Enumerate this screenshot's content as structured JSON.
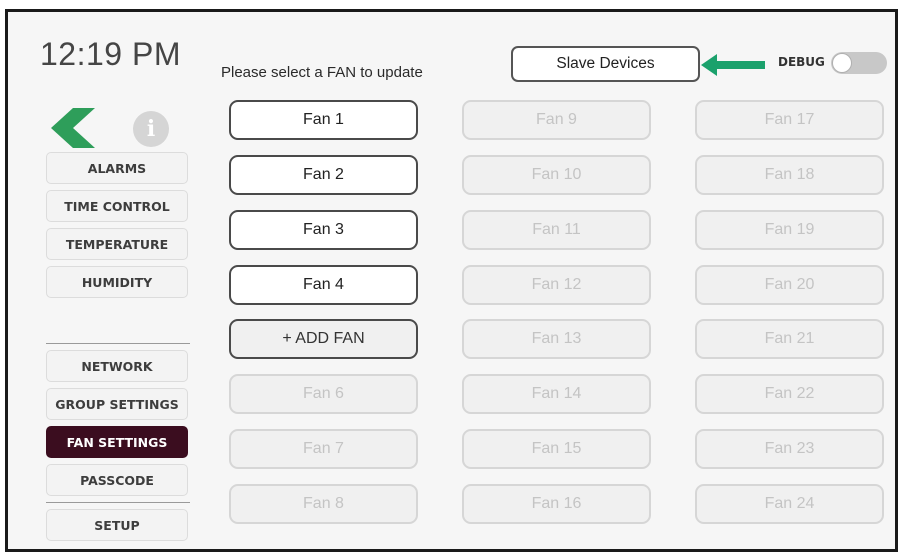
{
  "header": {
    "time": "12:19 PM",
    "prompt": "Please select a FAN to update",
    "slave_devices_label": "Slave Devices",
    "debug_label": "DEBUG",
    "debug_on": false
  },
  "sidebar": {
    "top_items": [
      {
        "label": "ALARMS"
      },
      {
        "label": "TIME CONTROL"
      },
      {
        "label": "TEMPERATURE"
      },
      {
        "label": "HUMIDITY"
      }
    ],
    "bottom_items": [
      {
        "label": "NETWORK"
      },
      {
        "label": "GROUP SETTINGS"
      },
      {
        "label": "FAN SETTINGS",
        "active": true
      },
      {
        "label": "PASSCODE"
      },
      {
        "label": "SETUP"
      }
    ],
    "info_glyph": "i"
  },
  "fans": {
    "col1": [
      "Fan 1",
      "Fan 2",
      "Fan 3",
      "Fan 4",
      "+ ADD FAN",
      "Fan 6",
      "Fan 7",
      "Fan 8"
    ],
    "col2": [
      "Fan 9",
      "Fan 10",
      "Fan 11",
      "Fan 12",
      "Fan 13",
      "Fan 14",
      "Fan 15",
      "Fan 16"
    ],
    "col3": [
      "Fan 17",
      "Fan 18",
      "Fan 19",
      "Fan 20",
      "Fan 21",
      "Fan 22",
      "Fan 23",
      "Fan 24"
    ]
  },
  "colors": {
    "accent_green": "#1ba16c",
    "active_nav": "#3b0d1f",
    "back_arrow": "#2e9e5a"
  },
  "icons": {
    "back": "chevron-left-icon",
    "info": "info-icon",
    "arrow": "arrow-left-icon"
  }
}
